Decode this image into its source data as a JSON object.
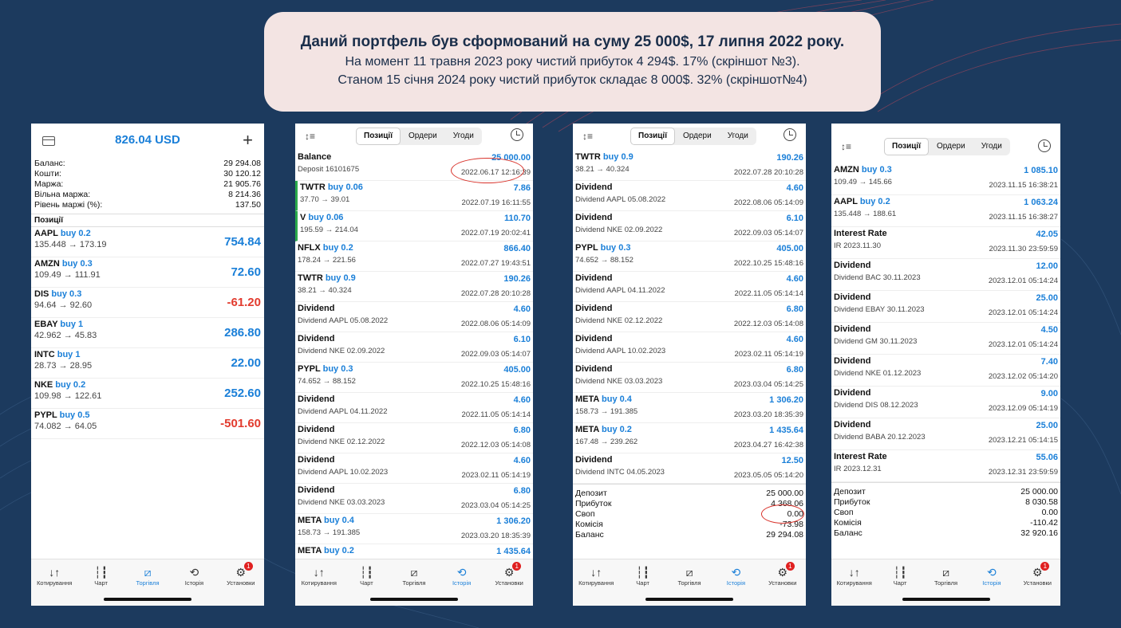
{
  "banner": {
    "line1": "Даний портфель був сформований на суму 25 000$, 17 липня 2022 року.",
    "line2": "На момент 11 травня 2023 року чистий прибуток 4 294$. 17% (скріншот №3).",
    "line3": "Станом 15 січня 2024 року чистий прибуток складає 8 000$. 32% (скріншот№4)"
  },
  "tabs": [
    "Котирування",
    "Чарт",
    "Торгівля",
    "Історія",
    "Установки"
  ],
  "tab_badge": "1",
  "seg_labels": [
    "Позиції",
    "Ордери",
    "Угоди"
  ],
  "screen1": {
    "balance": "826.04 USD",
    "account": [
      {
        "k": "Баланс:",
        "v": "29 294.08"
      },
      {
        "k": "Кошти:",
        "v": "30 120.12"
      },
      {
        "k": "Маржа:",
        "v": "21 905.76"
      },
      {
        "k": "Вільна маржа:",
        "v": "8 214.36"
      },
      {
        "k": "Рівень маржі (%):",
        "v": "137.50"
      }
    ],
    "positions_title": "Позиції",
    "positions": [
      {
        "sym": "AAPL",
        "side": "buy 0.2",
        "price": "135.448 → 173.19",
        "pl": "754.84",
        "neg": false
      },
      {
        "sym": "AMZN",
        "side": "buy 0.3",
        "price": "109.49 → 111.91",
        "pl": "72.60",
        "neg": false
      },
      {
        "sym": "DIS",
        "side": "buy 0.3",
        "price": "94.64 → 92.60",
        "pl": "-61.20",
        "neg": true
      },
      {
        "sym": "EBAY",
        "side": "buy 1",
        "price": "42.962 → 45.83",
        "pl": "286.80",
        "neg": false
      },
      {
        "sym": "INTC",
        "side": "buy 1",
        "price": "28.73 → 28.95",
        "pl": "22.00",
        "neg": false
      },
      {
        "sym": "NKE",
        "side": "buy 0.2",
        "price": "109.98 → 122.61",
        "pl": "252.60",
        "neg": false
      },
      {
        "sym": "PYPL",
        "side": "buy 0.5",
        "price": "74.082 → 64.05",
        "pl": "-501.60",
        "neg": true
      }
    ]
  },
  "screen2": {
    "rows": [
      {
        "t": "Balance",
        "side": "",
        "s": "Deposit 16101675",
        "a": "25 000.00",
        "d": "2022.06.17 12:16:39"
      },
      {
        "t": "TWTR",
        "side": "buy 0.06",
        "s": "37.70 → 39.01",
        "a": "7.86",
        "d": "2022.07.19 16:11:55"
      },
      {
        "t": "V",
        "side": "buy 0.06",
        "s": "195.59 → 214.04",
        "a": "110.70",
        "d": "2022.07.19 20:02:41"
      },
      {
        "t": "NFLX",
        "side": "buy 0.2",
        "s": "178.24 → 221.56",
        "a": "866.40",
        "d": "2022.07.27 19:43:51"
      },
      {
        "t": "TWTR",
        "side": "buy 0.9",
        "s": "38.21 → 40.324",
        "a": "190.26",
        "d": "2022.07.28 20:10:28"
      },
      {
        "t": "Dividend",
        "side": "",
        "s": "Dividend AAPL 05.08.2022",
        "a": "4.60",
        "d": "2022.08.06 05:14:09"
      },
      {
        "t": "Dividend",
        "side": "",
        "s": "Dividend NKE 02.09.2022",
        "a": "6.10",
        "d": "2022.09.03 05:14:07"
      },
      {
        "t": "PYPL",
        "side": "buy 0.3",
        "s": "74.652 → 88.152",
        "a": "405.00",
        "d": "2022.10.25 15:48:16"
      },
      {
        "t": "Dividend",
        "side": "",
        "s": "Dividend AAPL 04.11.2022",
        "a": "4.60",
        "d": "2022.11.05 05:14:14"
      },
      {
        "t": "Dividend",
        "side": "",
        "s": "Dividend NKE 02.12.2022",
        "a": "6.80",
        "d": "2022.12.03 05:14:08"
      },
      {
        "t": "Dividend",
        "side": "",
        "s": "Dividend AAPL 10.02.2023",
        "a": "4.60",
        "d": "2023.02.11 05:14:19"
      },
      {
        "t": "Dividend",
        "side": "",
        "s": "Dividend NKE 03.03.2023",
        "a": "6.80",
        "d": "2023.03.04 05:14:25"
      },
      {
        "t": "META",
        "side": "buy 0.4",
        "s": "158.73 → 191.385",
        "a": "1 306.20",
        "d": "2023.03.20 18:35:39"
      },
      {
        "t": "META",
        "side": "buy 0.2",
        "s": "",
        "a": "1 435.64",
        "d": ""
      }
    ]
  },
  "screen3": {
    "rows": [
      {
        "t": "TWTR",
        "side": "buy 0.9",
        "s": "38.21 → 40.324",
        "a": "190.26",
        "d": "2022.07.28 20:10:28"
      },
      {
        "t": "Dividend",
        "side": "",
        "s": "Dividend AAPL 05.08.2022",
        "a": "4.60",
        "d": "2022.08.06 05:14:09"
      },
      {
        "t": "Dividend",
        "side": "",
        "s": "Dividend NKE 02.09.2022",
        "a": "6.10",
        "d": "2022.09.03 05:14:07"
      },
      {
        "t": "PYPL",
        "side": "buy 0.3",
        "s": "74.652 → 88.152",
        "a": "405.00",
        "d": "2022.10.25 15:48:16"
      },
      {
        "t": "Dividend",
        "side": "",
        "s": "Dividend AAPL 04.11.2022",
        "a": "4.60",
        "d": "2022.11.05 05:14:14"
      },
      {
        "t": "Dividend",
        "side": "",
        "s": "Dividend NKE 02.12.2022",
        "a": "6.80",
        "d": "2022.12.03 05:14:08"
      },
      {
        "t": "Dividend",
        "side": "",
        "s": "Dividend AAPL 10.02.2023",
        "a": "4.60",
        "d": "2023.02.11 05:14:19"
      },
      {
        "t": "Dividend",
        "side": "",
        "s": "Dividend NKE 03.03.2023",
        "a": "6.80",
        "d": "2023.03.04 05:14:25"
      },
      {
        "t": "META",
        "side": "buy 0.4",
        "s": "158.73 → 191.385",
        "a": "1 306.20",
        "d": "2023.03.20 18:35:39"
      },
      {
        "t": "META",
        "side": "buy 0.2",
        "s": "167.48 → 239.262",
        "a": "1 435.64",
        "d": "2023.04.27 16:42:38"
      },
      {
        "t": "Dividend",
        "side": "",
        "s": "Dividend INTC 04.05.2023",
        "a": "12.50",
        "d": "2023.05.05 05:14:20"
      }
    ],
    "summary": [
      {
        "k": "Депозит",
        "v": "25 000.00"
      },
      {
        "k": "Прибуток",
        "v": "4 368.06"
      },
      {
        "k": "Своп",
        "v": "0.00"
      },
      {
        "k": "Комісія",
        "v": "-73.98"
      },
      {
        "k": "Баланс",
        "v": "29 294.08"
      }
    ]
  },
  "screen4": {
    "rows": [
      {
        "t": "AMZN",
        "side": "buy 0.3",
        "s": "109.49 → 145.66",
        "a": "1 085.10",
        "d": "2023.11.15 16:38:21"
      },
      {
        "t": "AAPL",
        "side": "buy 0.2",
        "s": "135.448 → 188.61",
        "a": "1 063.24",
        "d": "2023.11.15 16:38:27"
      },
      {
        "t": "Interest Rate",
        "side": "",
        "s": "IR 2023.11.30",
        "a": "42.05",
        "d": "2023.11.30 23:59:59"
      },
      {
        "t": "Dividend",
        "side": "",
        "s": "Dividend BAC 30.11.2023",
        "a": "12.00",
        "d": "2023.12.01 05:14:24"
      },
      {
        "t": "Dividend",
        "side": "",
        "s": "Dividend EBAY 30.11.2023",
        "a": "25.00",
        "d": "2023.12.01 05:14:24"
      },
      {
        "t": "Dividend",
        "side": "",
        "s": "Dividend GM 30.11.2023",
        "a": "4.50",
        "d": "2023.12.01 05:14:24"
      },
      {
        "t": "Dividend",
        "side": "",
        "s": "Dividend NKE 01.12.2023",
        "a": "7.40",
        "d": "2023.12.02 05:14:20"
      },
      {
        "t": "Dividend",
        "side": "",
        "s": "Dividend DIS 08.12.2023",
        "a": "9.00",
        "d": "2023.12.09 05:14:19"
      },
      {
        "t": "Dividend",
        "side": "",
        "s": "Dividend BABA 20.12.2023",
        "a": "25.00",
        "d": "2023.12.21 05:14:15"
      },
      {
        "t": "Interest Rate",
        "side": "",
        "s": "IR 2023.12.31",
        "a": "55.06",
        "d": "2023.12.31 23:59:59"
      }
    ],
    "summary": [
      {
        "k": "Депозит",
        "v": "25 000.00"
      },
      {
        "k": "Прибуток",
        "v": "8 030.58"
      },
      {
        "k": "Своп",
        "v": "0.00"
      },
      {
        "k": "Комісія",
        "v": "-110.42"
      },
      {
        "k": "Баланс",
        "v": "32 920.16"
      }
    ]
  }
}
